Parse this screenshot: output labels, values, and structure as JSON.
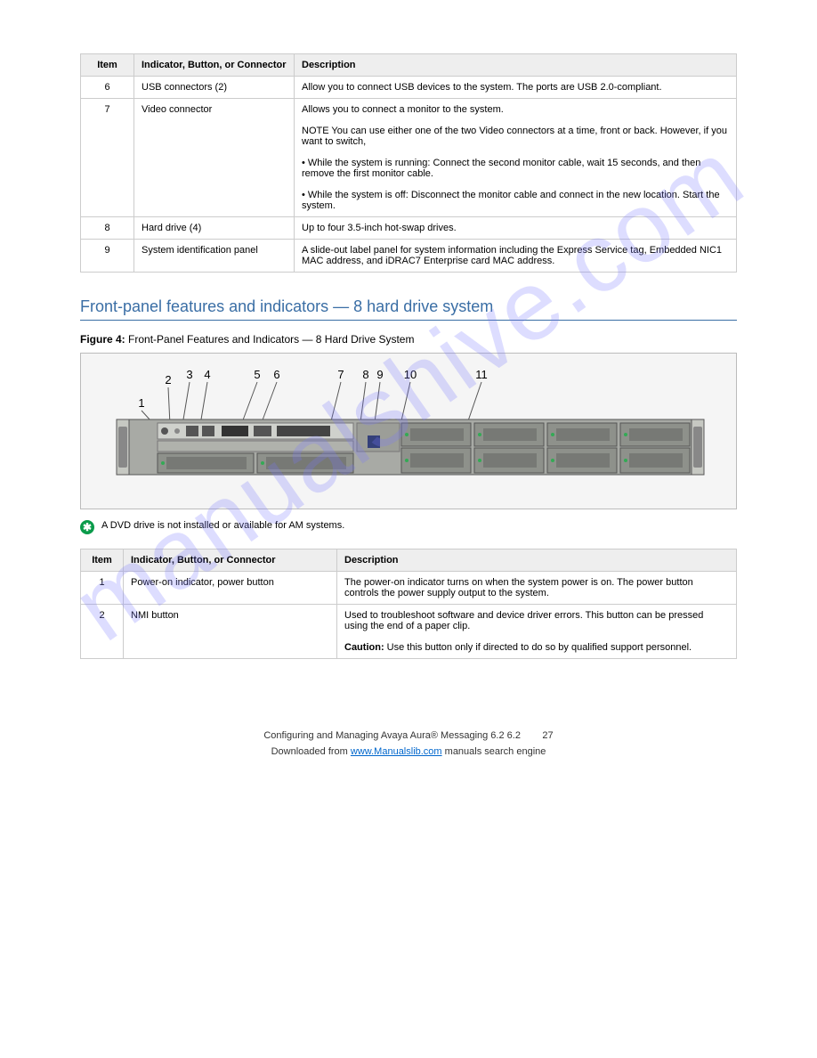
{
  "table1": {
    "headers": {
      "item": "Item",
      "indicator": "Indicator, Button, or Connector",
      "desc": "Description"
    },
    "rows": [
      {
        "item": "6",
        "indicator": "USB connectors (2)",
        "desc": "Allow you to connect USB devices to the system. The ports are USB 2.0-compliant."
      },
      {
        "item": "7",
        "indicator": "Video connector",
        "desc_parts": [
          "Allows you to connect a monitor to the system.",
          "NOTE You can use either one of the two Video connectors at a time, front or back. However, if you want to switch,",
          "• While the system is running: Connect the second monitor cable, wait 15 seconds, and then remove the first monitor cable.",
          "• While the system is off: Disconnect the monitor cable and connect in the new location. Start the system."
        ]
      },
      {
        "item": "8",
        "indicator": "Hard drive (4)",
        "desc": "Up to four 3.5-inch hot-swap drives."
      },
      {
        "item": "9",
        "indicator": "System identification panel",
        "desc": "A slide-out label panel for system information including the Express Service tag, Embedded NIC1 MAC address, and iDRAC7 Enterprise card MAC address."
      }
    ]
  },
  "section_title": "Front-panel features and indicators — 8 hard drive system",
  "figure": {
    "label": "Figure 4:",
    "title": "Front-Panel Features and Indicators — 8 Hard Drive System"
  },
  "diagram_numbers": [
    "1",
    "2",
    "3",
    "4",
    "5",
    "6",
    "7",
    "8",
    "9",
    "10",
    "11"
  ],
  "note": {
    "body": "A DVD drive is not installed or available for AM systems."
  },
  "table2": {
    "headers": {
      "item": "Item",
      "indicator": "Indicator, Button, or Connector",
      "desc": "Description"
    },
    "rows": [
      {
        "item": "1",
        "indicator": "Power-on indicator, power button",
        "desc": "The power-on indicator turns on when the system power is on. The power button controls the power supply output to the system."
      },
      {
        "item": "2",
        "indicator": "NMI button",
        "desc_parts": [
          "Used to troubleshoot software and device driver errors. This button can be pressed using the end of a paper clip.",
          "Use this button only if directed to do so by qualified support personnel."
        ],
        "caution": "Caution: "
      }
    ]
  },
  "footer": {
    "line1": "Configuring and Managing Avaya Aura® Messaging 6.2 6.2",
    "page": "27",
    "line2_pre": "Downloaded from ",
    "line2_link": "www.Manualslib.com",
    "line2_post": " manuals search engine"
  }
}
